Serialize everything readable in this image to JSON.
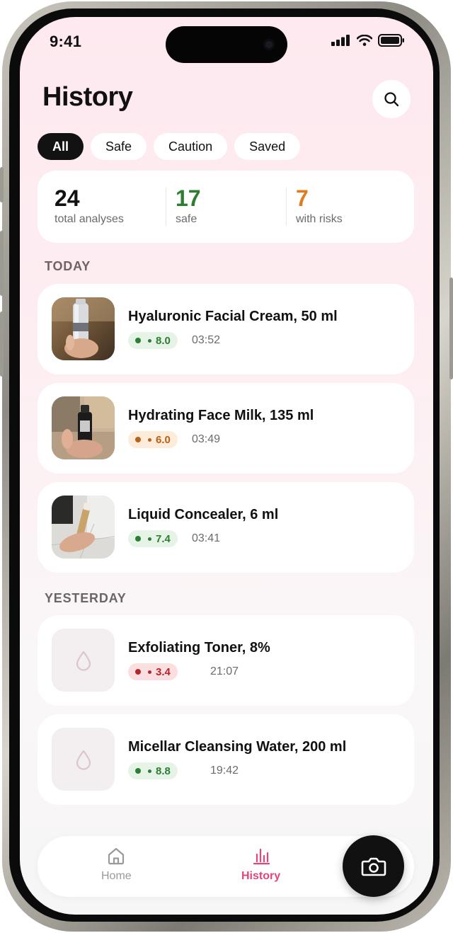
{
  "status_bar": {
    "time": "9:41"
  },
  "header": {
    "title": "History",
    "search_icon": "search-icon"
  },
  "filters": [
    {
      "label": "All",
      "active": true
    },
    {
      "label": "Safe",
      "active": false
    },
    {
      "label": "Caution",
      "active": false
    },
    {
      "label": "Saved",
      "active": false
    }
  ],
  "stats": [
    {
      "value": "24",
      "label": "total analyses",
      "color": "#111111"
    },
    {
      "value": "17",
      "label": "safe",
      "color": "#2e7d32"
    },
    {
      "value": "7",
      "label": "with risks",
      "color": "#e07b1f"
    }
  ],
  "sections": [
    {
      "title": "TODAY",
      "items": [
        {
          "name": "Hyaluronic Facial Cream, 50 ml",
          "score": "8.0",
          "time": "03:52",
          "level": "safe",
          "thumb": "photo-serum-bottle"
        },
        {
          "name": "Hydrating Face Milk, 135 ml",
          "score": "6.0",
          "time": "03:49",
          "level": "caution",
          "thumb": "photo-dark-bottle"
        },
        {
          "name": "Liquid Concealer, 6 ml",
          "score": "7.4",
          "time": "03:41",
          "level": "safe",
          "thumb": "photo-concealer-tube"
        }
      ]
    },
    {
      "title": "YESTERDAY",
      "items": [
        {
          "name": "Exfoliating Toner, 8%",
          "score": "3.4",
          "time": "21:07",
          "level": "risk",
          "thumb": "drop-icon"
        },
        {
          "name": "Micellar Cleansing Water, 200 ml",
          "score": "8.8",
          "time": "19:42",
          "level": "safe",
          "thumb": "drop-icon"
        }
      ]
    }
  ],
  "levels": {
    "safe": {
      "bg": "#e6f4e7",
      "fg": "#2e7d32"
    },
    "caution": {
      "bg": "#fdecd9",
      "fg": "#b8611a"
    },
    "risk": {
      "bg": "#fbdfe0",
      "fg": "#b3262d"
    }
  },
  "nav": {
    "home": {
      "label": "Home",
      "icon": "home-icon",
      "active": false,
      "color": "#9a9a9a"
    },
    "history": {
      "label": "History",
      "icon": "bar-chart-icon",
      "active": true,
      "color": "#e0457b"
    },
    "camera": {
      "icon": "camera-icon"
    }
  }
}
